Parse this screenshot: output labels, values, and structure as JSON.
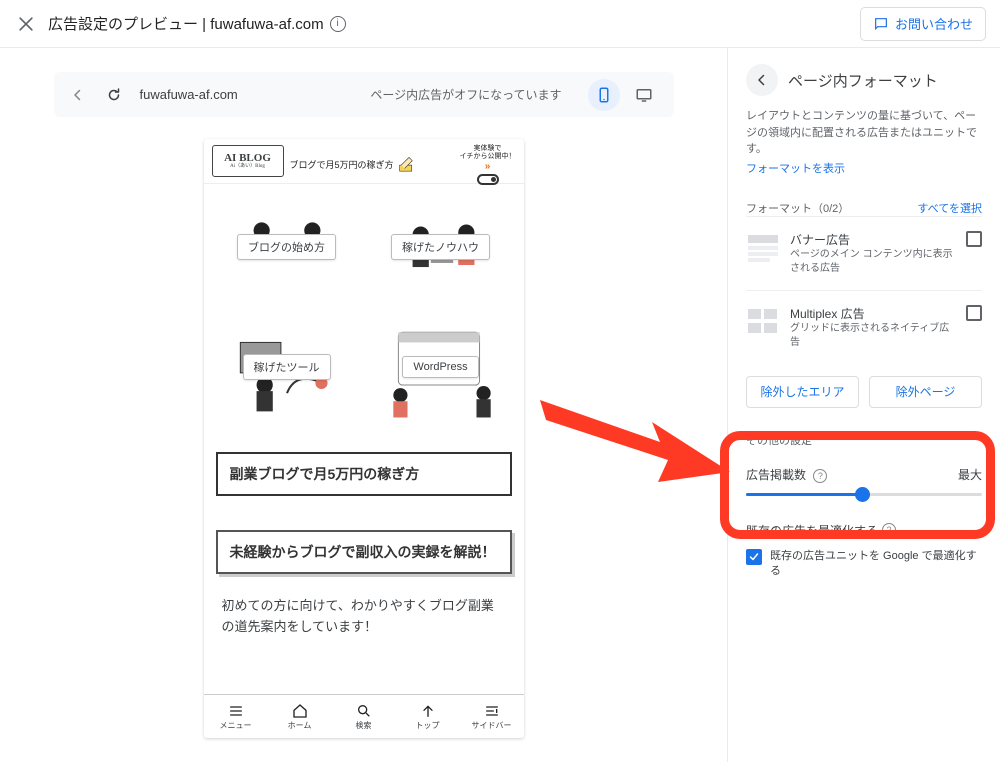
{
  "header": {
    "title": "広告設定のプレビュー | fuwafuwa-af.com",
    "contact_label": "お問い合わせ"
  },
  "preview_bar": {
    "url": "fuwafuwa-af.com",
    "status": "ページ内広告がオフになっています"
  },
  "site": {
    "logo_main": "AI BLOG",
    "logo_sub": "Ai（あい）Blog",
    "tagline": "ブログで月5万円の稼ぎ方",
    "header_note_1": "実体験で",
    "header_note_2": "イチから公開中！",
    "categories": [
      {
        "label": "ブログの始め方"
      },
      {
        "label": "稼げたノウハウ"
      },
      {
        "label": "稼げたツール"
      },
      {
        "label": "WordPress"
      }
    ],
    "article_1": "副業ブログで月5万円の稼ぎ方",
    "article_2": "未経験からブログで副収入の実録を解説！",
    "intro": "初めての方に向けて、わかりやすくブログ副業の道先案内をしています！",
    "bottom_nav": [
      {
        "label": "メニュー"
      },
      {
        "label": "ホーム"
      },
      {
        "label": "検索"
      },
      {
        "label": "トップ"
      },
      {
        "label": "サイドバー"
      }
    ]
  },
  "panel": {
    "title": "ページ内フォーマット",
    "desc": "レイアウトとコンテンツの量に基づいて、ページの領域内に配置される広告またはユニットです。",
    "link": "フォーマットを表示",
    "sub_label": "フォーマット（0/2）",
    "select_all": "すべてを選択",
    "formats": [
      {
        "title": "バナー広告",
        "desc": "ページのメイン コンテンツ内に表示される広告"
      },
      {
        "title": "Multiplex 広告",
        "desc": "グリッドに表示されるネイティブ広告"
      }
    ],
    "btn_exclude_area": "除外したエリア",
    "btn_exclude_page": "除外ページ",
    "other_settings": "その他の設定",
    "ad_count_label": "広告掲載数",
    "ad_count_max": "最大",
    "optimize_title": "既存の広告を最適化する",
    "optimize_text": "既存の広告ユニットを Google で最適化する"
  }
}
